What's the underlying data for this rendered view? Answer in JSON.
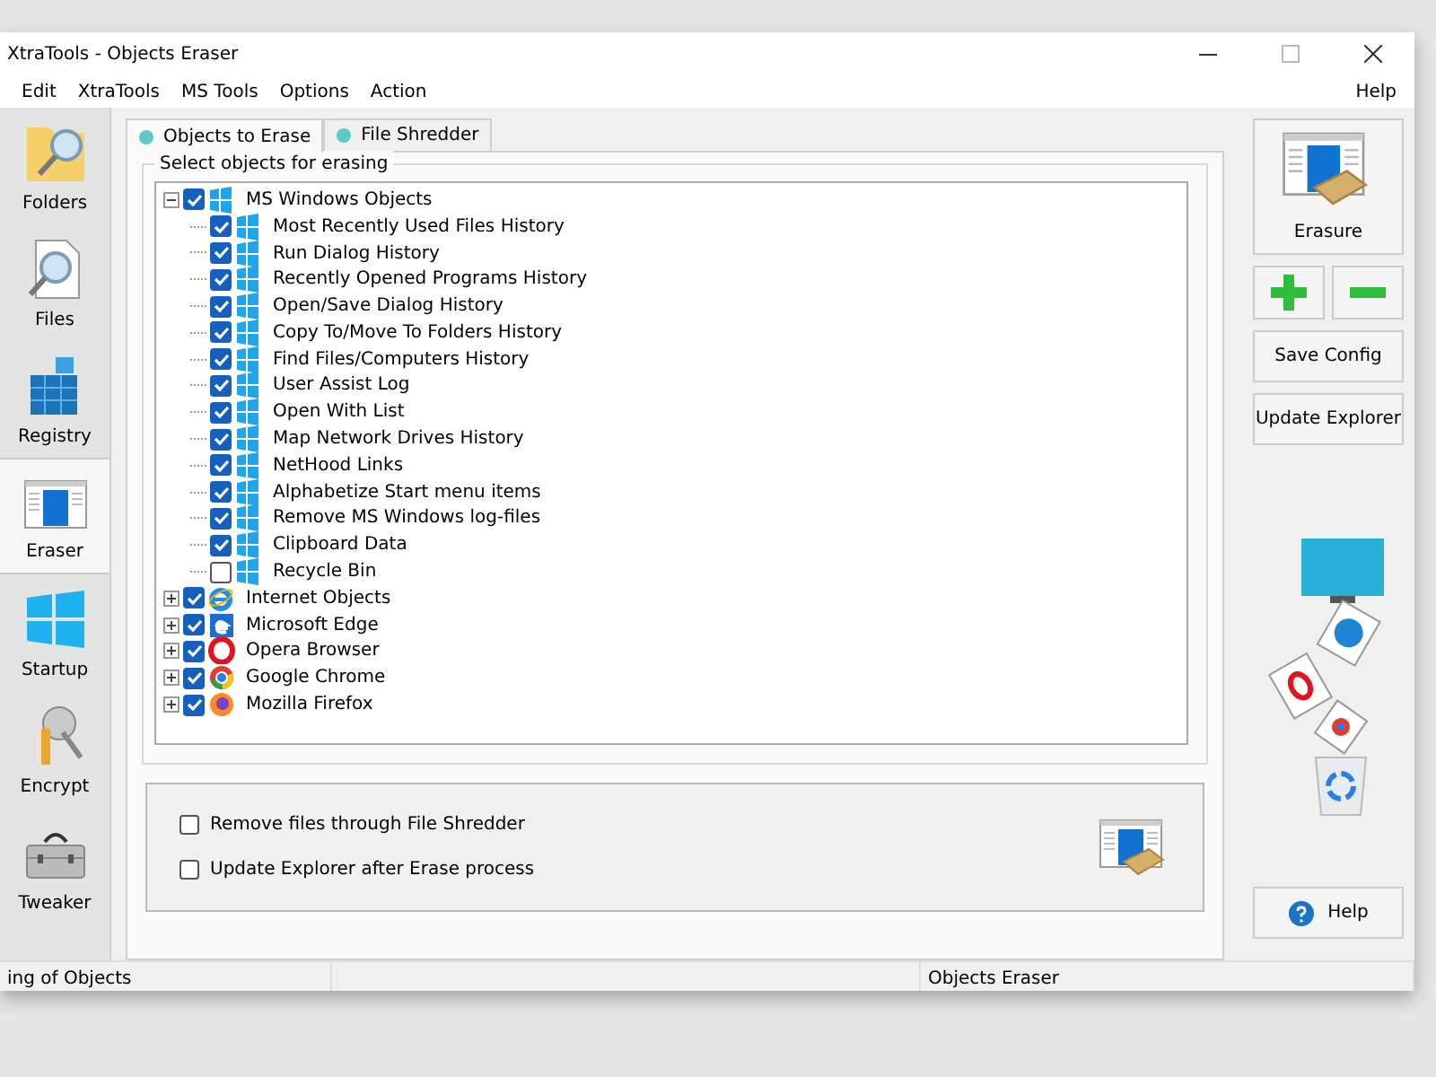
{
  "window": {
    "title": "XtraTools - Objects Eraser"
  },
  "menu": [
    "Edit",
    "XtraTools",
    "MS Tools",
    "Options",
    "Action"
  ],
  "menu_right": "Help",
  "sidebar": {
    "items": [
      {
        "label": "Folders",
        "kind": "folders",
        "selected": false
      },
      {
        "label": "Files",
        "kind": "files",
        "selected": false
      },
      {
        "label": "Registry",
        "kind": "registry",
        "selected": false
      },
      {
        "label": "Eraser",
        "kind": "eraser",
        "selected": true
      },
      {
        "label": "Startup",
        "kind": "startup",
        "selected": false
      },
      {
        "label": "Encrypt",
        "kind": "encrypt",
        "selected": false
      },
      {
        "label": "Tweaker",
        "kind": "tweaker",
        "selected": false
      }
    ]
  },
  "tabs": [
    {
      "label": "Objects to Erase",
      "selected": true
    },
    {
      "label": "File Shredder",
      "selected": false
    }
  ],
  "group_title": "Select objects for erasing",
  "tree": [
    {
      "label": "MS Windows Objects",
      "kind": "windows",
      "checked": true,
      "expanded": true,
      "children": [
        {
          "label": "Most Recently Used Files History",
          "kind": "windows",
          "checked": true
        },
        {
          "label": "Run Dialog History",
          "kind": "windows",
          "checked": true
        },
        {
          "label": "Recently Opened Programs History",
          "kind": "windows",
          "checked": true
        },
        {
          "label": "Open/Save Dialog History",
          "kind": "windows",
          "checked": true
        },
        {
          "label": "Copy To/Move To Folders History",
          "kind": "windows",
          "checked": true
        },
        {
          "label": "Find Files/Computers History",
          "kind": "windows",
          "checked": true
        },
        {
          "label": "User Assist Log",
          "kind": "windows",
          "checked": true
        },
        {
          "label": "Open With List",
          "kind": "windows",
          "checked": true
        },
        {
          "label": "Map Network Drives History",
          "kind": "windows",
          "checked": true
        },
        {
          "label": "NetHood Links",
          "kind": "windows",
          "checked": true
        },
        {
          "label": "Alphabetize Start menu items",
          "kind": "windows",
          "checked": true
        },
        {
          "label": "Remove MS Windows log-files",
          "kind": "windows",
          "checked": true
        },
        {
          "label": "Clipboard Data",
          "kind": "windows",
          "checked": true
        },
        {
          "label": "Recycle Bin",
          "kind": "windows",
          "checked": false
        }
      ]
    },
    {
      "label": "Internet Objects",
      "kind": "ie",
      "checked": true,
      "expanded": false
    },
    {
      "label": "Microsoft Edge",
      "kind": "edge",
      "checked": true,
      "expanded": false
    },
    {
      "label": "Opera Browser",
      "kind": "opera",
      "checked": true,
      "expanded": false
    },
    {
      "label": "Google Chrome",
      "kind": "chrome",
      "checked": true,
      "expanded": false
    },
    {
      "label": "Mozilla Firefox",
      "kind": "firefox",
      "checked": true,
      "expanded": false
    }
  ],
  "options": [
    {
      "label": "Remove files through File Shredder",
      "checked": false
    },
    {
      "label": "Update Explorer after Erase process",
      "checked": false
    }
  ],
  "buttons": {
    "erasure": "Erasure",
    "save": "Save Config",
    "update": "Update Explorer",
    "help": "Help"
  },
  "status_bar": {
    "left": "ing of Objects",
    "right": "Objects Eraser"
  }
}
